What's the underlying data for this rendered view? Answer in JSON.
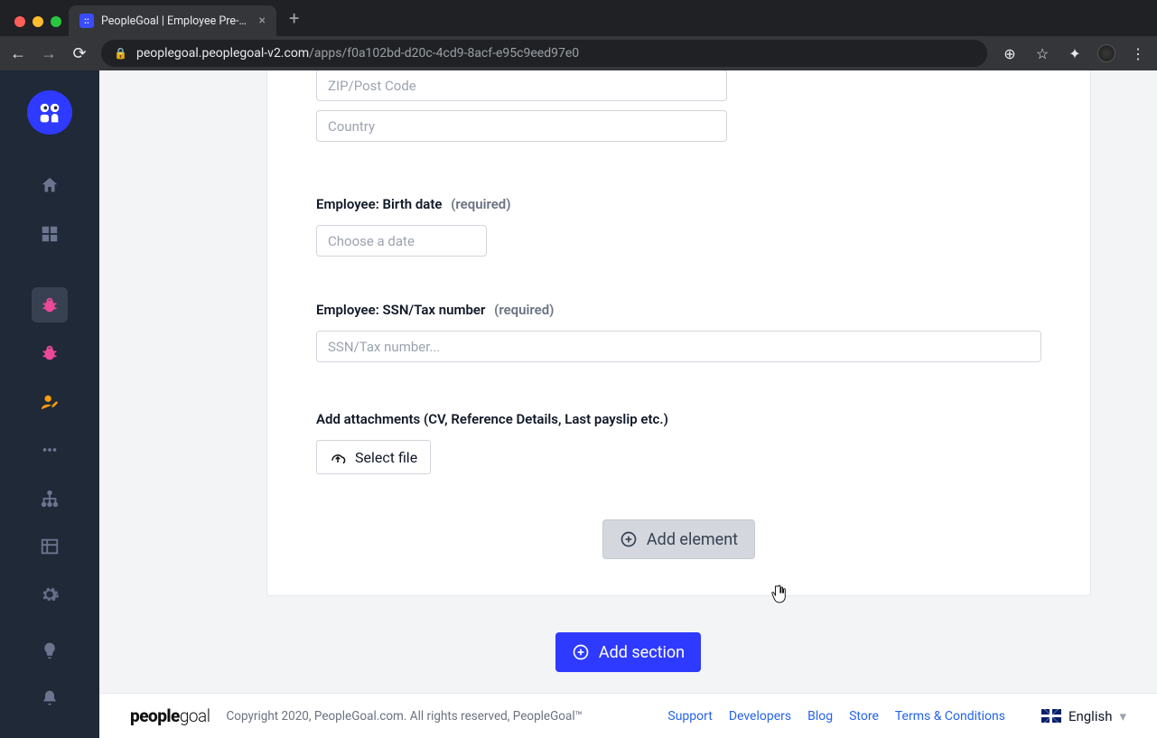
{
  "browser": {
    "tab_title": "PeopleGoal | Employee Pre-On",
    "url_domain": "peoplegoal.peoplegoal-v2.com",
    "url_path": "/apps/f0a102bd-d20c-4cd9-8acf-e95c9eed97e0"
  },
  "form": {
    "zip_placeholder": "ZIP/Post Code",
    "country_placeholder": "Country",
    "birth_label": "Employee: Birth date",
    "birth_required": "(required)",
    "birth_placeholder": "Choose a date",
    "ssn_label": "Employee: SSN/Tax number",
    "ssn_required": "(required)",
    "ssn_placeholder": "SSN/Tax number...",
    "attach_label": "Add attachments (CV, Reference Details, Last payslip etc.)",
    "select_file": "Select file",
    "add_element": "Add element",
    "add_section": "Add section"
  },
  "footer": {
    "brand1": "people",
    "brand2": "goal",
    "copyright": "Copyright 2020, PeopleGoal.com. All rights reserved, PeopleGoal™",
    "support": "Support",
    "developers": "Developers",
    "blog": "Blog",
    "store": "Store",
    "terms": "Terms & Conditions",
    "language": "English"
  }
}
